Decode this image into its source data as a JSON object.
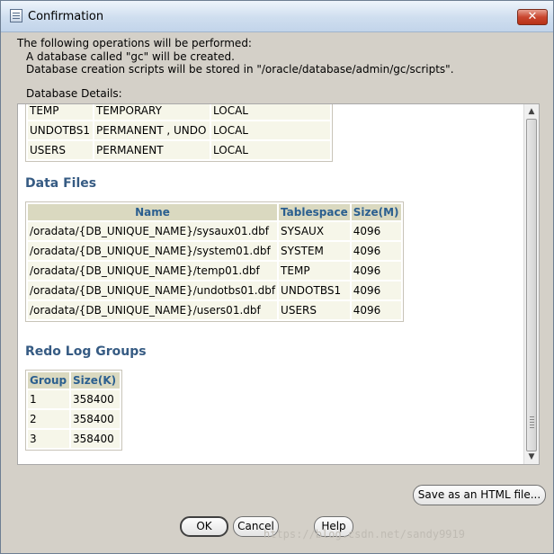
{
  "window": {
    "title": "Confirmation",
    "close_label": "✕"
  },
  "intro": {
    "line1": "The following operations will be performed:",
    "line2": "A database called \"gc\" will be created.",
    "line3": "Database creation scripts will be stored in \"/oracle/database/admin/gc/scripts\"."
  },
  "details_label": "Database Details:",
  "tablespaces": {
    "rows": [
      [
        "TEMP",
        "TEMPORARY",
        "LOCAL"
      ],
      [
        "UNDOTBS1",
        "PERMANENT , UNDO",
        "LOCAL"
      ],
      [
        "USERS",
        "PERMANENT",
        "LOCAL"
      ]
    ]
  },
  "data_files": {
    "title": "Data Files",
    "headers": [
      "Name",
      "Tablespace",
      "Size(M)"
    ],
    "rows": [
      [
        "/oradata/{DB_UNIQUE_NAME}/sysaux01.dbf",
        "SYSAUX",
        "4096"
      ],
      [
        "/oradata/{DB_UNIQUE_NAME}/system01.dbf",
        "SYSTEM",
        "4096"
      ],
      [
        "/oradata/{DB_UNIQUE_NAME}/temp01.dbf",
        "TEMP",
        "4096"
      ],
      [
        "/oradata/{DB_UNIQUE_NAME}/undotbs01.dbf",
        "UNDOTBS1",
        "4096"
      ],
      [
        "/oradata/{DB_UNIQUE_NAME}/users01.dbf",
        "USERS",
        "4096"
      ]
    ]
  },
  "redo_log_groups": {
    "title": "Redo Log Groups",
    "headers": [
      "Group",
      "Size(K)"
    ],
    "rows": [
      [
        "1",
        "358400"
      ],
      [
        "2",
        "358400"
      ],
      [
        "3",
        "358400"
      ]
    ]
  },
  "buttons": {
    "save_html": "Save as an HTML file...",
    "ok": "OK",
    "cancel": "Cancel",
    "help": "Help"
  },
  "watermark": "https://blog.csdn.net/sandy9919"
}
